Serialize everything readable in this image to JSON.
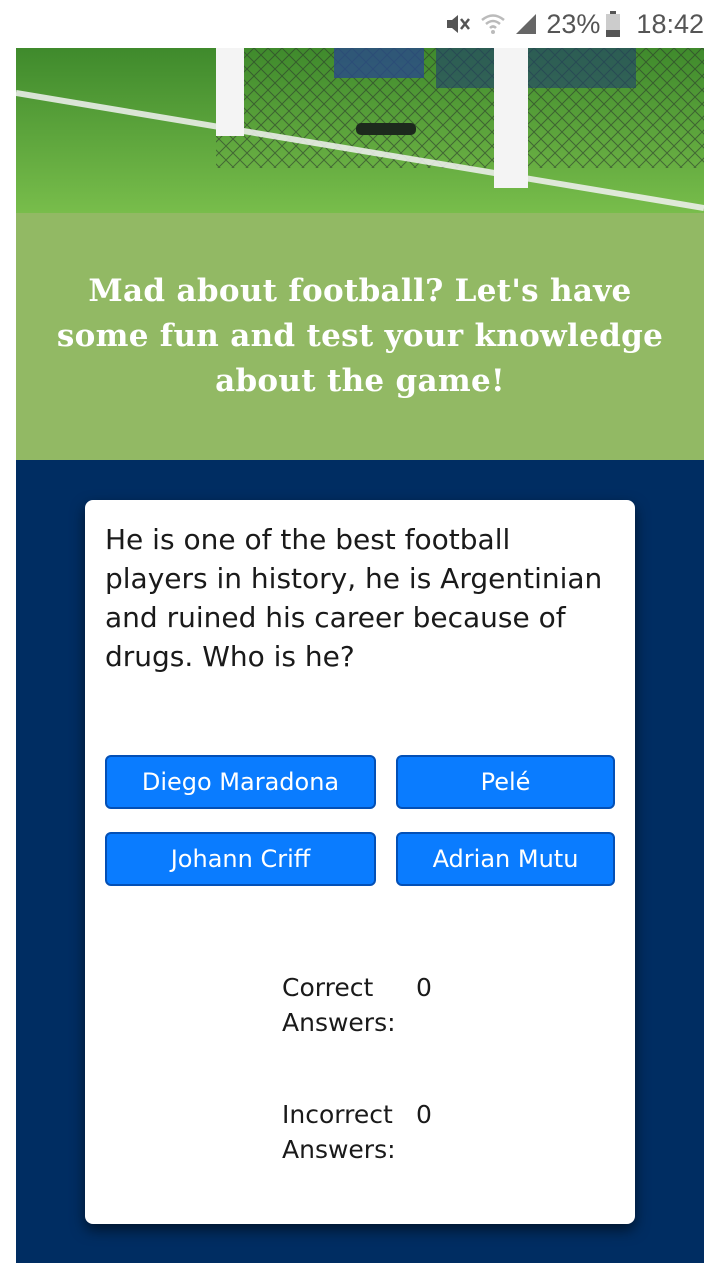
{
  "status_bar": {
    "icons": [
      "mute-icon",
      "wifi-icon",
      "signal-icon",
      "battery-icon"
    ],
    "battery_percent": "23%",
    "time": "18:42"
  },
  "headline": {
    "text": "Mad about football? Let's have some fun and test your knowledge about the game!"
  },
  "quiz": {
    "question": "He is one of the best football players in history, he is Argentinian and ruined his career because of drugs. Who is he?",
    "answers": [
      "Diego Maradona",
      "Pelé",
      "Johann Criff",
      "Adrian Mutu"
    ]
  },
  "score": {
    "correct_label": "Correct Answers:",
    "correct_value": "0",
    "incorrect_label": "Incorrect Answers:",
    "incorrect_value": "0"
  },
  "colors": {
    "headline_band": "#92b964",
    "quiz_background": "#002d62",
    "answer_button": "#0a7cff",
    "answer_border": "#0350b6"
  }
}
